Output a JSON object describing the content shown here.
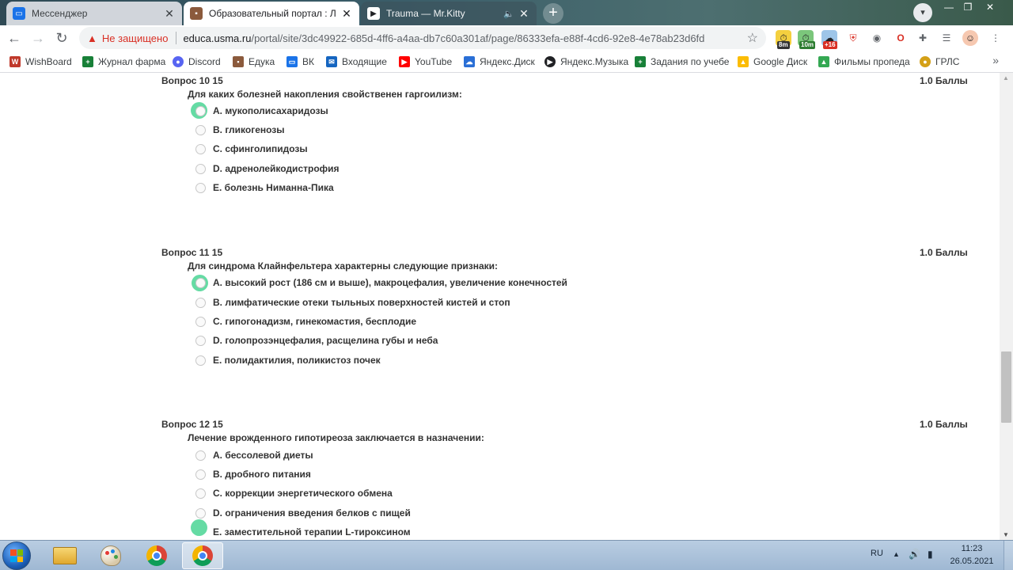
{
  "tabs": [
    {
      "title": "Мессенджер",
      "close": "✕"
    },
    {
      "title": "Образовательный портал : Л Н",
      "close": "✕"
    },
    {
      "title": "Trauma — Mr.Kitty",
      "close": "✕"
    }
  ],
  "window_controls": {
    "minimize": "—",
    "restore": "❐",
    "close": "✕"
  },
  "toolbar": {
    "not_secure": "Не защищено",
    "url_host": "educa.usma.ru",
    "url_path": "/portal/site/3dc49922-685d-4ff6-a4aa-db7c60a301af/page/86333efa-e88f-4cd6-92e8-4e78ab23d6fd",
    "ext_badges": [
      "8m",
      "10m",
      "+16"
    ]
  },
  "bookmarks": [
    "WishBoard",
    "Журнал фарма",
    "Discord",
    "Едука",
    "ВК",
    "Входящие",
    "YouTube",
    "Яндекс.Диск",
    "Яндекс.Музыка",
    "Задания по учебе",
    "Google Диск",
    "Фильмы пропеда",
    "ГРЛС"
  ],
  "questions": [
    {
      "header": "Вопрос 10 15",
      "score": "1.0 Баллы",
      "text": "Для каких болезней накопления свойственен гаргоилизм:",
      "options": [
        "A. мукополисахаридозы",
        "B. гликогенозы",
        "C. сфинголипидозы",
        "D. адренолейкодистрофия",
        "E. болезнь Нимaнна-Пика"
      ],
      "selected": 0
    },
    {
      "header": "Вопрос 11 15",
      "score": "1.0 Баллы",
      "text": "Для синдрома Клайнфельтера характерны следующие признаки:",
      "options": [
        "A. высокий рост (186 см и выше), макроцефалия, увеличение конечностей",
        "B. лимфатические отеки тыльных поверхностей кистей и стоп",
        "C. гипогонадизм, гинекомастия, бесплодие",
        "D. голопрозэнцефалия, расщелина губы и неба",
        "E. полидактилия, поликистоз почек"
      ],
      "selected": 0
    },
    {
      "header": "Вопрос 12 15",
      "score": "1.0 Баллы",
      "text": "Лечение врожденного гипотиреоза заключается в назначении:",
      "options": [
        "A. бессолевой диеты",
        "B. дробного питания",
        "C. коррекции энергетического обмена",
        "D. ограничения введения белков с пищей",
        "E. заместительной терапии L-тироксином"
      ],
      "selected": 4
    }
  ],
  "selection_color": "#65dba4",
  "taskbar": {
    "lang": "RU",
    "time": "11:23",
    "date": "26.05.2021"
  }
}
